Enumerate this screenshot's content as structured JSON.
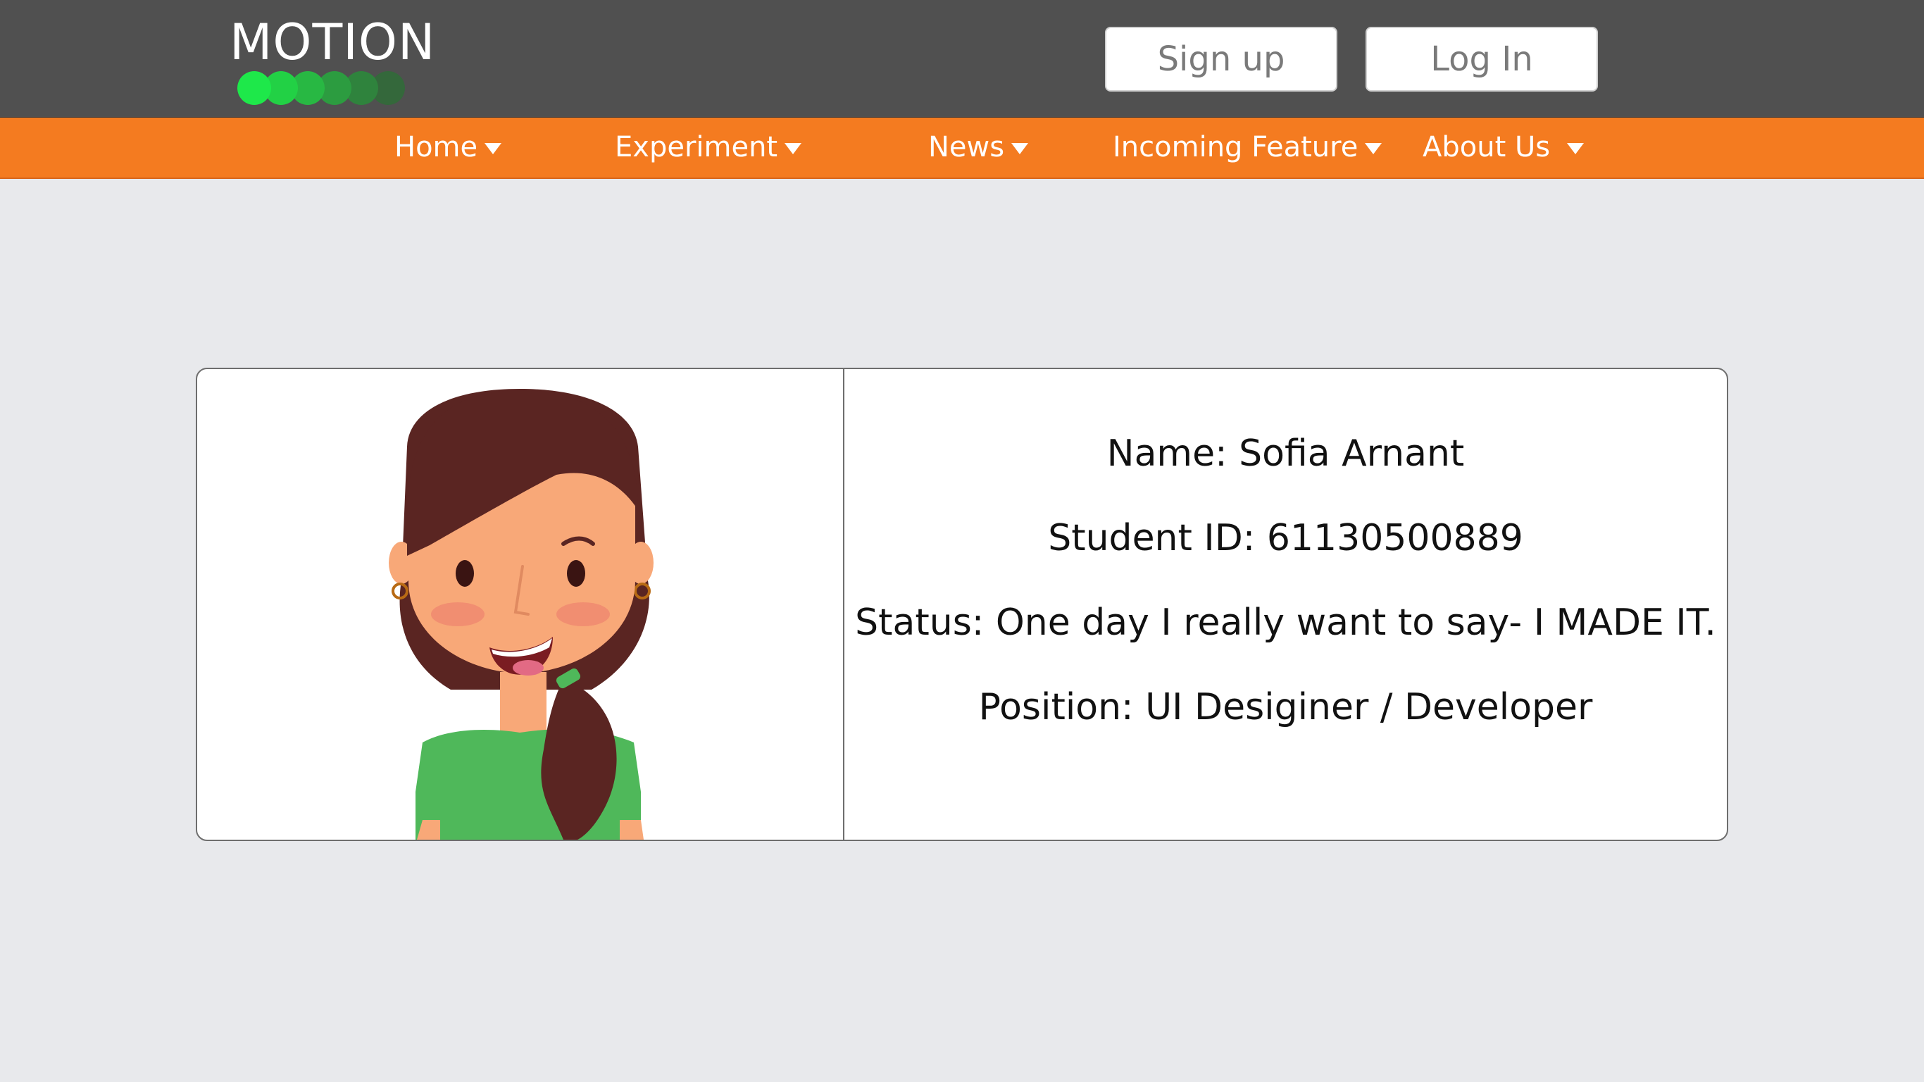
{
  "brand": {
    "name": "MOTION",
    "dot_colors": [
      "#1ee84a",
      "#22d145",
      "#28b843",
      "#2c9c40",
      "#2f833d",
      "#34683b",
      "#3a5a3c"
    ]
  },
  "header": {
    "signup_label": "Sign up",
    "login_label": "Log In"
  },
  "nav": {
    "items": [
      {
        "label": "Home"
      },
      {
        "label": "Experiment"
      },
      {
        "label": "News"
      },
      {
        "label": "Incoming Feature"
      },
      {
        "label": "About Us"
      }
    ]
  },
  "profile": {
    "name_line": "Name:  Sofia Arnant",
    "id_line": "Student ID: 61130500889",
    "status_line": "Status: One day I really want to say- I MADE IT.",
    "position_line": "Position: UI Desiginer / Developer"
  },
  "colors": {
    "header_bg": "#505050",
    "nav_bg": "#f47b20",
    "page_bg": "#e8e9ec"
  }
}
